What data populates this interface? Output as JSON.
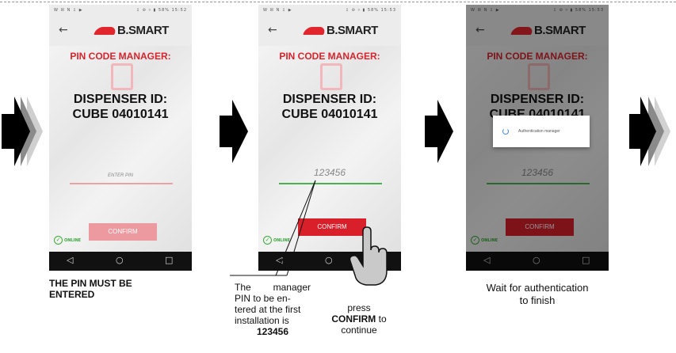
{
  "screens": [
    {
      "status_left": "W ☒ N ⇩ ▶",
      "status_right": "⇩ ⊘ ▿ ▮ 58% 15:52",
      "back": "←",
      "logo": "B.SMART",
      "title": "PIN CODE MANAGER:",
      "dispenser_line1": "DISPENSER ID:",
      "dispenser_line2": "CUBE 04010141",
      "pin_value": "ENTER PIN",
      "confirm_label": "CONFIRM",
      "online_label": "ONLINE",
      "nav_back": "◁",
      "nav_home": "○",
      "nav_recent": "□"
    },
    {
      "status_left": "W ☒ N ⇩ ▶",
      "status_right": "⇩ ⊘ ▿ ▮ 58% 15:53",
      "back": "←",
      "logo": "B.SMART",
      "title": "PIN CODE MANAGER:",
      "dispenser_line1": "DISPENSER ID:",
      "dispenser_line2": "CUBE 04010141",
      "pin_value": "123456",
      "confirm_label": "CONFIRM",
      "online_label": "ONLINE",
      "nav_back": "◁",
      "nav_home": "○",
      "nav_recent": "□"
    },
    {
      "status_left": "W ☒ N ⇩ ▶",
      "status_right": "⇩ ⊘ ▿ ▮ 58% 15:53",
      "back": "←",
      "logo": "B.SMART",
      "title": "PIN CODE MANAGER:",
      "dispenser_line1": "DISPENSER ID:",
      "dispenser_line2": "CUBE 04010141",
      "pin_value": "123456",
      "confirm_label": "CONFIRM",
      "online_label": "ONLINE",
      "dialog_text": "Authentication manager",
      "nav_back": "◁",
      "nav_home": "○",
      "nav_recent": "□"
    }
  ],
  "captions": {
    "step1_line1": "THE PIN MUST BE",
    "step1_line2": "ENTERED",
    "step2_the": "The",
    "step2_manager": "manager",
    "step2_line2": "PIN to be en-",
    "step2_line3": "tered at the first",
    "step2_line4": "installation is",
    "step2_pin": "123456",
    "step2b_press": "press",
    "step2b_confirm": "CONFIRM",
    "step2b_to": "to",
    "step2b_continue": "continue",
    "step3_line1": "Wait for authentication",
    "step3_line2": "to finish"
  },
  "colors": {
    "brand_red": "#e2262d",
    "confirm_faded": "#ec9aa0",
    "confirm_active": "#d81f2a",
    "online_green": "#3aa83a"
  }
}
